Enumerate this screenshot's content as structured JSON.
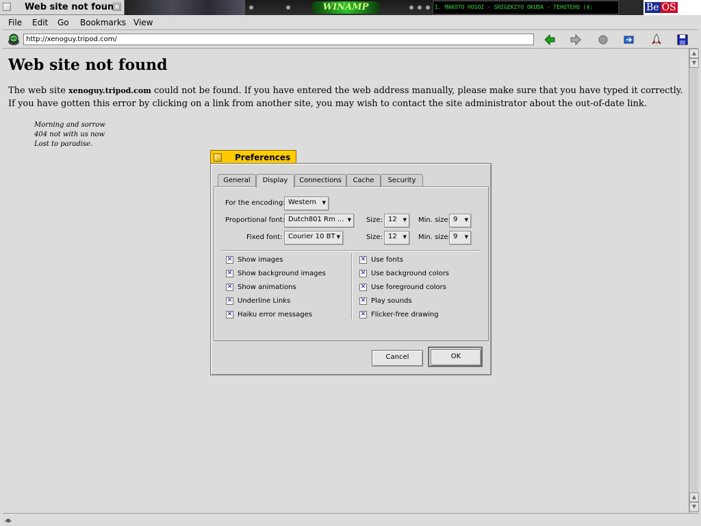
{
  "window": {
    "title": "Web site not found"
  },
  "deskbar": {
    "winamp_logo": "WINAMP",
    "track": "1. MAKOTO HOSOI - SHIGEKIYO OKUDA - TEHUTEHU (4:",
    "beos_be": "Be",
    "beos_os": "OS"
  },
  "menu": [
    "File",
    "Edit",
    "Go",
    "Bookmarks",
    "View"
  ],
  "toolbar": {
    "url": "http://xenoguy.tripod.com/",
    "icons": [
      "back-arrow-icon",
      "forward-arrow-icon",
      "stop-icon",
      "home-icon",
      "rocket-icon",
      "save-disk-icon"
    ],
    "back_color": "#1aa01a",
    "accent_yellow": "#ffcb00"
  },
  "page": {
    "heading": "Web site not found",
    "p_before": "The web site ",
    "p_site": "xenoguy.tripod.com",
    "p_after": " could not be found. If you have entered the web address manually, please make sure that you have typed it correctly. If you have gotten this error by clicking on a link from another site, you may wish to contact the site administrator about the out-of-date link.",
    "poem": [
      "Morning and sorrow",
      "404 not with us now",
      "Lost to paradise."
    ]
  },
  "dialog": {
    "title": "Preferences",
    "tabs": [
      "General",
      "Display",
      "Connections",
      "Cache",
      "Security"
    ],
    "active_tab": "Display",
    "encoding_label": "For the encoding:",
    "encoding_value": "Western",
    "prop_font_label": "Proportional font:",
    "prop_font_value": "Dutch801 Rm ...",
    "fixed_font_label": "Fixed font:",
    "fixed_font_value": "Courier 10 BT",
    "size_label": "Size:",
    "size_value": "12",
    "min_size_label": "Min. size:",
    "min_size_value": "9",
    "left_checks": [
      "Show images",
      "Show background images",
      "Show animations",
      "Underline Links",
      "Haiku error messages"
    ],
    "right_checks": [
      "Use fonts",
      "Use background colors",
      "Use foreground colors",
      "Play sounds",
      "Flicker-free drawing"
    ],
    "check_mark": "✕",
    "cancel_label": "Cancel",
    "ok_label": "OK"
  }
}
